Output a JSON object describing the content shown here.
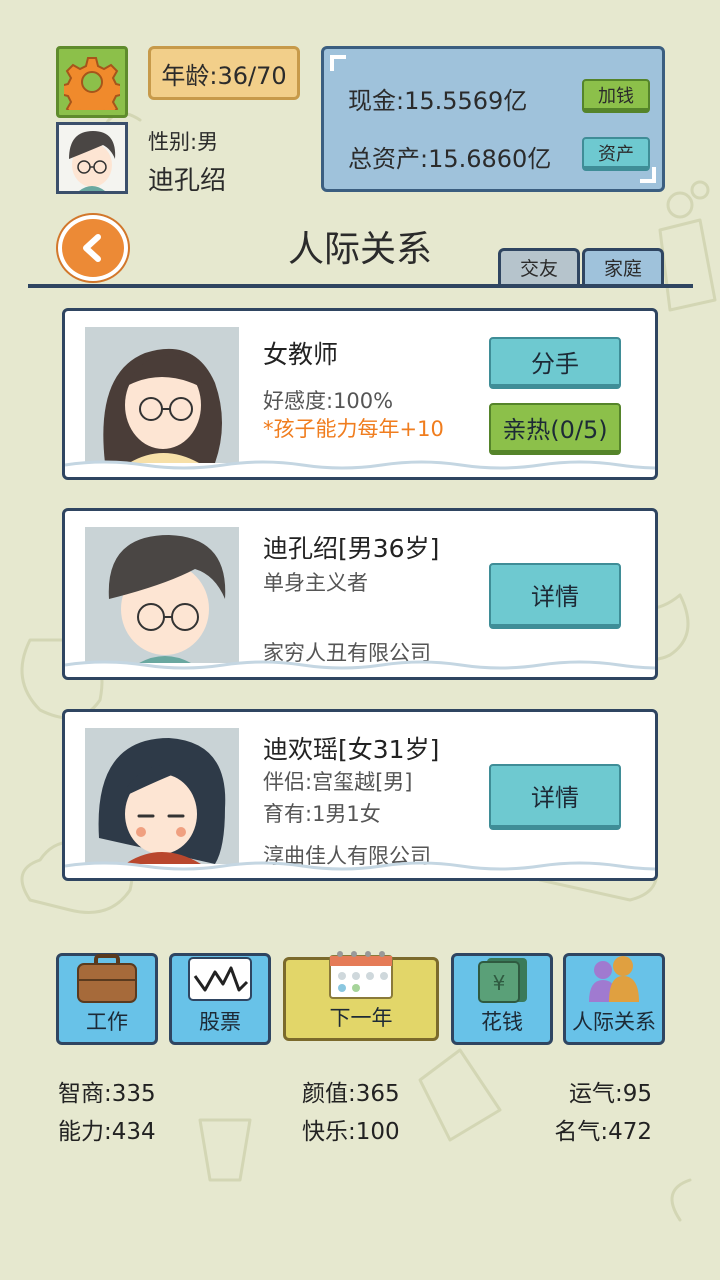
{
  "player": {
    "age_text": "年龄:36/70",
    "gender_text": "性别:男",
    "name": "迪孔绍"
  },
  "money": {
    "cash_label": "现金:15.5569亿",
    "cash_button": "加钱",
    "assets_label": "总资产:15.6860亿",
    "assets_button": "资产"
  },
  "page": {
    "title": "人际关系",
    "tabs": [
      "交友",
      "家庭"
    ],
    "active_tab": "家庭"
  },
  "cards": [
    {
      "name": "女教师",
      "line1": "好感度:100%",
      "line2": "*孩子能力每年+10",
      "buttons": [
        "分手",
        "亲热(0/5)"
      ]
    },
    {
      "name": "迪孔绍[男36岁]",
      "line1": "单身主义者",
      "company": "家穷人丑有限公司",
      "button": "详情"
    },
    {
      "name": "迪欢瑶[女31岁]",
      "line1": "伴侣:宫玺越[男]",
      "line2": "育有:1男1女",
      "company": "淳曲佳人有限公司",
      "button": "详情"
    }
  ],
  "nav": {
    "work": "工作",
    "stocks": "股票",
    "next_year": "下一年",
    "spend": "花钱",
    "relations": "人际关系"
  },
  "stats": {
    "iq": "智商:335",
    "looks": "颜值:365",
    "luck": "运气:95",
    "ability": "能力:434",
    "happiness": "快乐:100",
    "fame": "名气:472"
  },
  "colors": {
    "background": "#e6e8cf",
    "panel_blue": "#9fc2db",
    "button_blue": "#6ec9d0",
    "button_green": "#8cc04a",
    "highlight_orange": "#f07d1e"
  }
}
